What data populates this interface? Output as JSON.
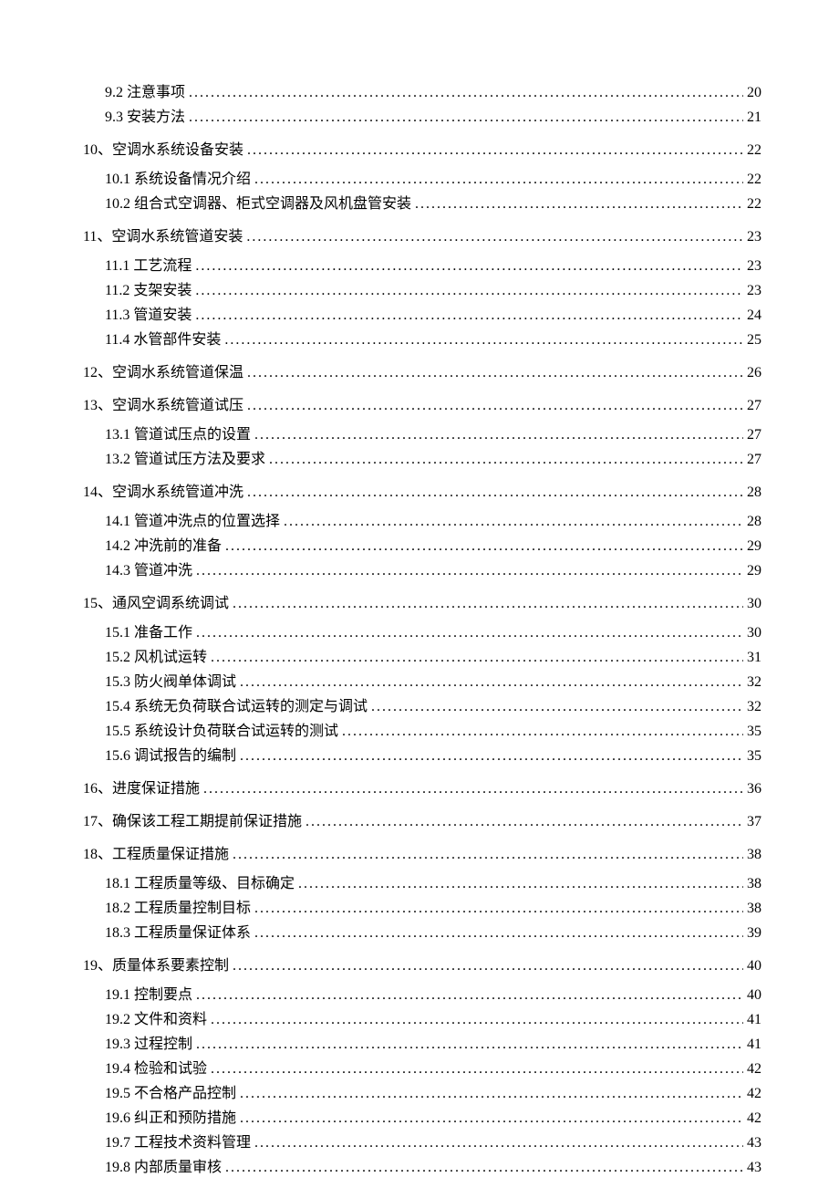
{
  "toc": [
    {
      "level": 2,
      "label": "9.2 注意事项",
      "page": "20"
    },
    {
      "level": 2,
      "label": "9.3 安装方法",
      "page": "21"
    },
    {
      "level": 1,
      "label": "10、空调水系统设备安装",
      "page": "22"
    },
    {
      "level": 2,
      "label": "10.1 系统设备情况介绍",
      "page": "22"
    },
    {
      "level": 2,
      "label": "10.2 组合式空调器、柜式空调器及风机盘管安装",
      "page": "22"
    },
    {
      "level": 1,
      "label": "11、空调水系统管道安装",
      "page": "23"
    },
    {
      "level": 2,
      "label": "11.1 工艺流程",
      "page": "23"
    },
    {
      "level": 2,
      "label": "11.2 支架安装",
      "page": "23"
    },
    {
      "level": 2,
      "label": "11.3 管道安装",
      "page": "24"
    },
    {
      "level": 2,
      "label": "11.4 水管部件安装",
      "page": "25"
    },
    {
      "level": 1,
      "label": "12、空调水系统管道保温",
      "page": "26"
    },
    {
      "level": 1,
      "label": "13、空调水系统管道试压",
      "page": "27"
    },
    {
      "level": 2,
      "label": "13.1 管道试压点的设置",
      "page": "27"
    },
    {
      "level": 2,
      "label": "13.2 管道试压方法及要求",
      "page": "27"
    },
    {
      "level": 1,
      "label": "14、空调水系统管道冲洗",
      "page": "28"
    },
    {
      "level": 2,
      "label": "14.1 管道冲洗点的位置选择",
      "page": "28"
    },
    {
      "level": 2,
      "label": "14.2 冲洗前的准备",
      "page": "29"
    },
    {
      "level": 2,
      "label": "14.3 管道冲洗",
      "page": "29"
    },
    {
      "level": 1,
      "label": "15、通风空调系统调试",
      "page": "30"
    },
    {
      "level": 2,
      "label": "15.1 准备工作",
      "page": "30"
    },
    {
      "level": 2,
      "label": "15.2 风机试运转",
      "page": "31"
    },
    {
      "level": 2,
      "label": "15.3 防火阀单体调试",
      "page": "32"
    },
    {
      "level": 2,
      "label": "15.4 系统无负荷联合试运转的测定与调试",
      "page": "32"
    },
    {
      "level": 2,
      "label": "15.5 系统设计负荷联合试运转的测试",
      "page": "35"
    },
    {
      "level": 2,
      "label": "15.6 调试报告的编制",
      "page": "35"
    },
    {
      "level": 1,
      "label": "16、进度保证措施",
      "page": "36"
    },
    {
      "level": 1,
      "label": "17、确保该工程工期提前保证措施",
      "page": "37"
    },
    {
      "level": 1,
      "label": "18、工程质量保证措施",
      "page": "38"
    },
    {
      "level": 2,
      "label": "18.1 工程质量等级、目标确定",
      "page": "38"
    },
    {
      "level": 2,
      "label": "18.2 工程质量控制目标",
      "page": "38"
    },
    {
      "level": 2,
      "label": "18.3 工程质量保证体系",
      "page": "39"
    },
    {
      "level": 1,
      "label": "19、质量体系要素控制",
      "page": "40"
    },
    {
      "level": 2,
      "label": "19.1 控制要点",
      "page": "40"
    },
    {
      "level": 2,
      "label": "19.2 文件和资料",
      "page": "41"
    },
    {
      "level": 2,
      "label": "19.3 过程控制",
      "page": "41"
    },
    {
      "level": 2,
      "label": "19.4 检验和试验",
      "page": "42"
    },
    {
      "level": 2,
      "label": "19.5 不合格产品控制",
      "page": "42"
    },
    {
      "level": 2,
      "label": "19.6 纠正和预防措施",
      "page": "42"
    },
    {
      "level": 2,
      "label": "19.7 工程技术资料管理",
      "page": "43"
    },
    {
      "level": 2,
      "label": "19.8 内部质量审核",
      "page": "43"
    }
  ]
}
